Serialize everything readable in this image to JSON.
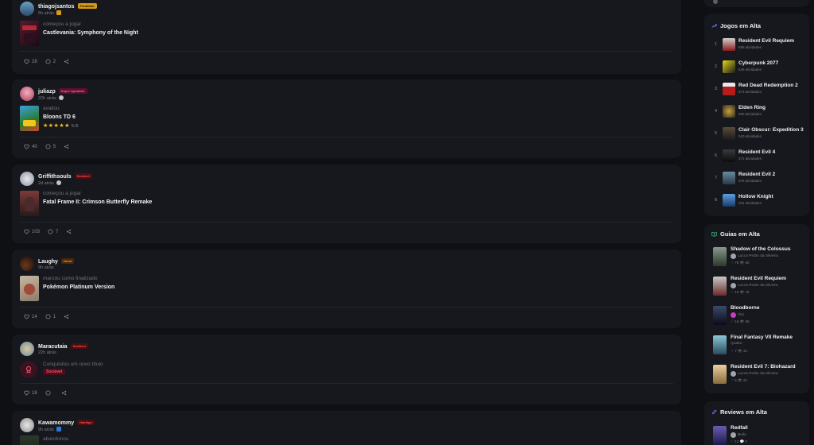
{
  "feed": [
    {
      "user": "thiagojsantos",
      "badge": "Fundador",
      "badge_color": "#d99a12",
      "time": "5h atrás",
      "action": "começou a jogar",
      "game": "Castlevania: Symphony of the Night",
      "likes": "28",
      "comments": "2",
      "cover_color": "#3a1d2a"
    },
    {
      "user": "juliazp",
      "badge": "Super Apoiador",
      "badge_color": "#c2185b",
      "time": "22h atrás",
      "action": "avaliou",
      "game": "Bloons TD 6",
      "rating_stars": "★★★★★",
      "rating_text": "5/5",
      "likes": "40",
      "comments": "5",
      "cover_color": "#d9472b"
    },
    {
      "user": "Griffithsouls",
      "badge": "Sociável",
      "badge_color": "#b71c1c",
      "time": "2d atrás",
      "action": "começou a jogar",
      "game": "Fatal Frame II: Crimson Butterfly Remake",
      "likes": "103",
      "comments": "7",
      "cover_color": "#4a2a2a"
    },
    {
      "user": "Laughy",
      "badge": "Herói",
      "badge_color": "#8d4a12",
      "time": "9h atrás",
      "action": "marcou como finalizado",
      "game": "Pokémon Platinum Version",
      "likes": "14",
      "comments": "1",
      "cover_color": "#7a6a5a"
    },
    {
      "user": "Maracutaia",
      "badge": "Sociável",
      "badge_color": "#b71c1c",
      "time": "22h atrás",
      "action": "Conquistou um novo título",
      "title_badge": "Sociável",
      "likes": "18",
      "comments": ""
    },
    {
      "user": "Kawamommy",
      "badge": "Habilign",
      "badge_color": "#b71c1c",
      "time": "9h atrás",
      "action": "abandonou"
    }
  ],
  "trending_games": {
    "title": "Jogos em Alta",
    "items": [
      {
        "rank": "1",
        "name": "Resident Evil Requiem",
        "sub": "596 atividades",
        "color": "#8a1a1a"
      },
      {
        "rank": "2",
        "name": "Cyberpunk 2077",
        "sub": "626 atividades",
        "color": "#e4d51a"
      },
      {
        "rank": "3",
        "name": "Red Dead Redemption 2",
        "sub": "573 atividades",
        "color": "#b71c1c"
      },
      {
        "rank": "4",
        "name": "Elden Ring",
        "sub": "550 atividades",
        "color": "#6a5a2a"
      },
      {
        "rank": "5",
        "name": "Clair Obscur: Expedition 33",
        "sub": "540 atividades",
        "color": "#3a3a4a"
      },
      {
        "rank": "6",
        "name": "Resident Evil 4",
        "sub": "371 atividades",
        "color": "#2a2a2a"
      },
      {
        "rank": "7",
        "name": "Resident Evil 2",
        "sub": "376 atividades",
        "color": "#3a4a5a"
      },
      {
        "rank": "8",
        "name": "Hollow Knight",
        "sub": "331 atividades",
        "color": "#2a5a8a"
      }
    ]
  },
  "trending_guides": {
    "title": "Guias em Alta",
    "items": [
      {
        "name": "Shadow of the Colossus",
        "author": "Lucca Pedro da Silveira",
        "stats": "♡ 76   👁 80",
        "color": "#4a5a4a"
      },
      {
        "name": "Resident Evil Requiem",
        "author": "Lucca Pedro da Silveira",
        "stats": "♡ 15   👁 78",
        "color": "#6a4a4a"
      },
      {
        "name": "Bloodborne",
        "author": "Vini",
        "stats": "♡ 16   👁 68",
        "color": "#2a3a5a"
      },
      {
        "name": "Final Fantasy VII Remake",
        "author": "ryuako",
        "stats": "♡ 7   👁 34",
        "color": "#3a6a7a"
      },
      {
        "name": "Resident Evil 7: Biohazard",
        "author": "Lucca Pedro da Silveira",
        "stats": "♡ 5   👁 22",
        "color": "#c4a070"
      }
    ]
  },
  "trending_reviews": {
    "title": "Reviews em Alta",
    "items": [
      {
        "name": "Redfall",
        "author": "Builo",
        "stats": "♡ 12  💬 6",
        "color": "#4a3a8a"
      }
    ]
  }
}
